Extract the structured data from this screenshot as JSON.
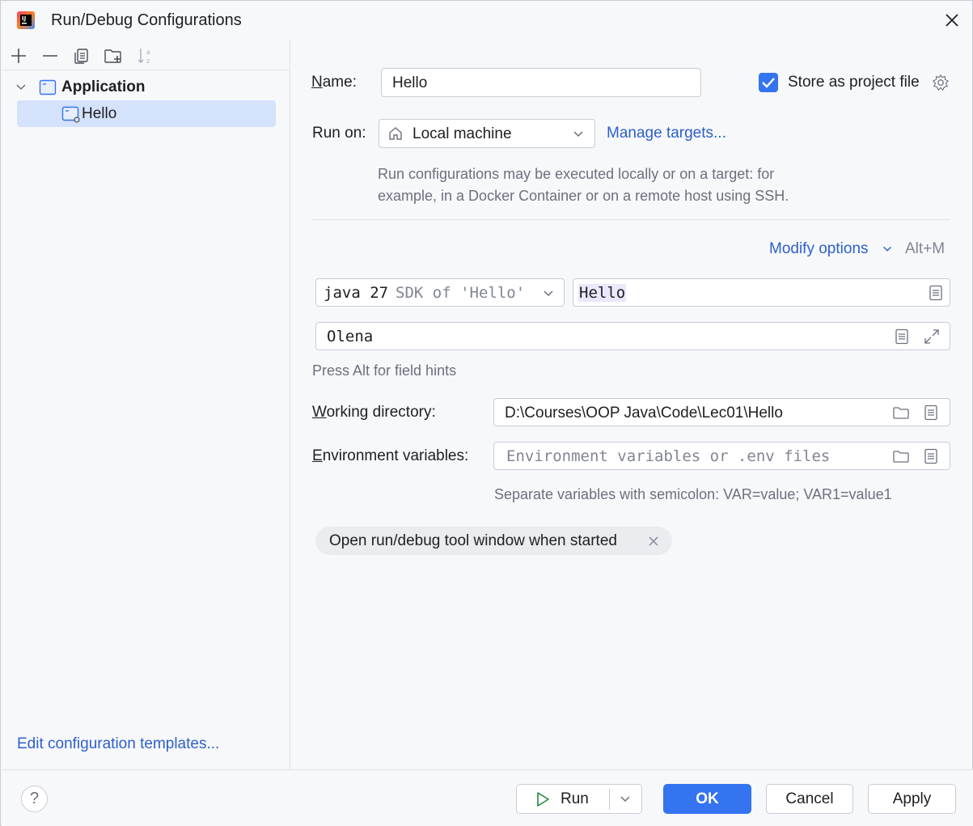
{
  "window": {
    "title": "Run/Debug Configurations"
  },
  "icons": {
    "app_logo": "intellij-logo-icon",
    "close": "close-icon",
    "add": "plus-icon",
    "remove": "minus-icon",
    "copy": "copy-icon",
    "new_folder": "new-folder-icon",
    "sort": "sort-alphabetically-icon",
    "gear": "gear-icon",
    "home": "home-icon",
    "folder": "folder-icon",
    "doc": "document-icon",
    "expand": "expand-icon",
    "play": "play-icon"
  },
  "colors": {
    "accent": "#3574f0",
    "link": "#2d5fcc",
    "selection": "#d4e2fc"
  },
  "sidebar": {
    "tree": [
      {
        "label": "Application",
        "expanded": true
      },
      {
        "label": "Hello",
        "selected": true
      }
    ],
    "edit_templates": "Edit configuration templates..."
  },
  "form": {
    "name_label": "Name:",
    "name_value": "Hello",
    "store_label": "Store as project file",
    "store_checked": true,
    "run_on_label": "Run on:",
    "run_on_value": "Local machine",
    "manage_targets": "Manage targets...",
    "run_on_hint_1": "Run configurations may be executed locally or on a target: for",
    "run_on_hint_2": "example, in a Docker Container or on a remote host using SSH.",
    "modify_options": "Modify options",
    "modify_shortcut": "Alt+M",
    "sdk_java": "java 27",
    "sdk_rest": "SDK of 'Hello'",
    "main_class": "Hello",
    "program_args": "Olena",
    "field_hint": "Press Alt for field hints",
    "workdir_label": "Working directory:",
    "workdir_value": "D:\\Courses\\OOP Java\\Code\\Lec01\\Hello",
    "env_label": "Environment variables:",
    "env_placeholder": "Environment variables or .env files",
    "env_hint": "Separate variables with semicolon: VAR=value; VAR1=value1",
    "tag_label": "Open run/debug tool window when started"
  },
  "buttons": {
    "help": "?",
    "run": "Run",
    "ok": "OK",
    "cancel": "Cancel",
    "apply": "Apply"
  }
}
